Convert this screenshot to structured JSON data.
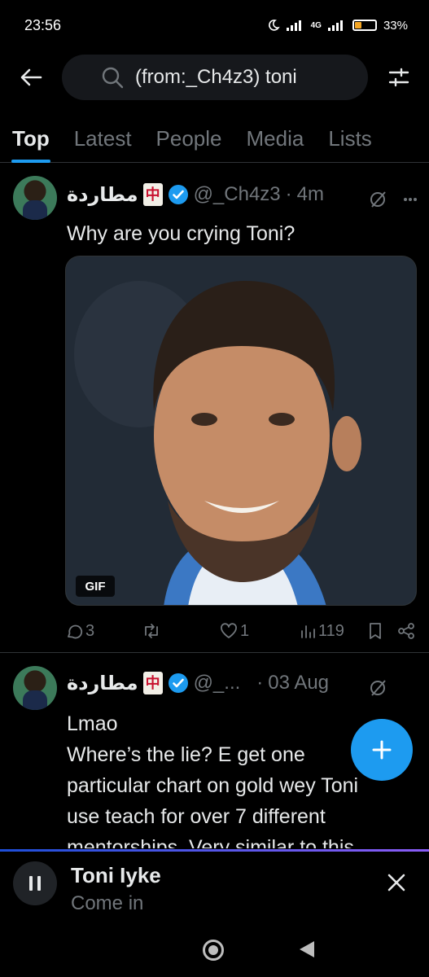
{
  "status": {
    "time": "23:56",
    "battery": "33%",
    "network": "4G"
  },
  "search": {
    "query": "(from:_Ch4z3) toni"
  },
  "tabs": [
    {
      "label": "Top"
    },
    {
      "label": "Latest"
    },
    {
      "label": "People"
    },
    {
      "label": "Media"
    },
    {
      "label": "Lists"
    }
  ],
  "tweets": [
    {
      "display_name": "مطاردة",
      "badge": "中",
      "handle": "@_Ch4z3",
      "dot": "·",
      "time": "4m",
      "text": "Why are you crying Toni?",
      "media_badge": "GIF",
      "replies": "3",
      "likes": "1",
      "views": "119"
    },
    {
      "display_name": "مطاردة",
      "badge": "中",
      "handle": "@_...",
      "dot": "·",
      "time": "03 Aug",
      "text_lines": [
        "Lmao",
        "Where’s the lie? E get one",
        "particular chart on gold wey Toni",
        "use teach for over 7 different",
        "mentorships. Very similar to this"
      ]
    }
  ],
  "audio_player": {
    "title": "Toni Iyke",
    "subtitle": "Come in"
  },
  "colors": {
    "accent": "#1d9bf0",
    "background": "#000000",
    "muted": "#71767b"
  }
}
